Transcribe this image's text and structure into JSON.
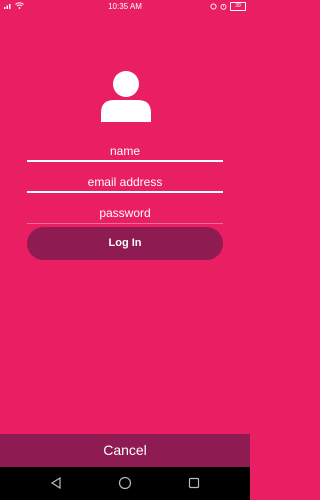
{
  "status_bar": {
    "time": "10:35 AM",
    "battery": "39"
  },
  "form": {
    "name_placeholder": "name",
    "email_placeholder": "email address",
    "password_placeholder": "password",
    "login_label": "Log In"
  },
  "cancel_label": "Cancel",
  "icons": {
    "avatar": "person-icon",
    "nav": [
      "back-icon",
      "home-icon",
      "recent-apps-icon"
    ]
  },
  "colors": {
    "background": "#e91e63",
    "button": "#8e1c52"
  }
}
